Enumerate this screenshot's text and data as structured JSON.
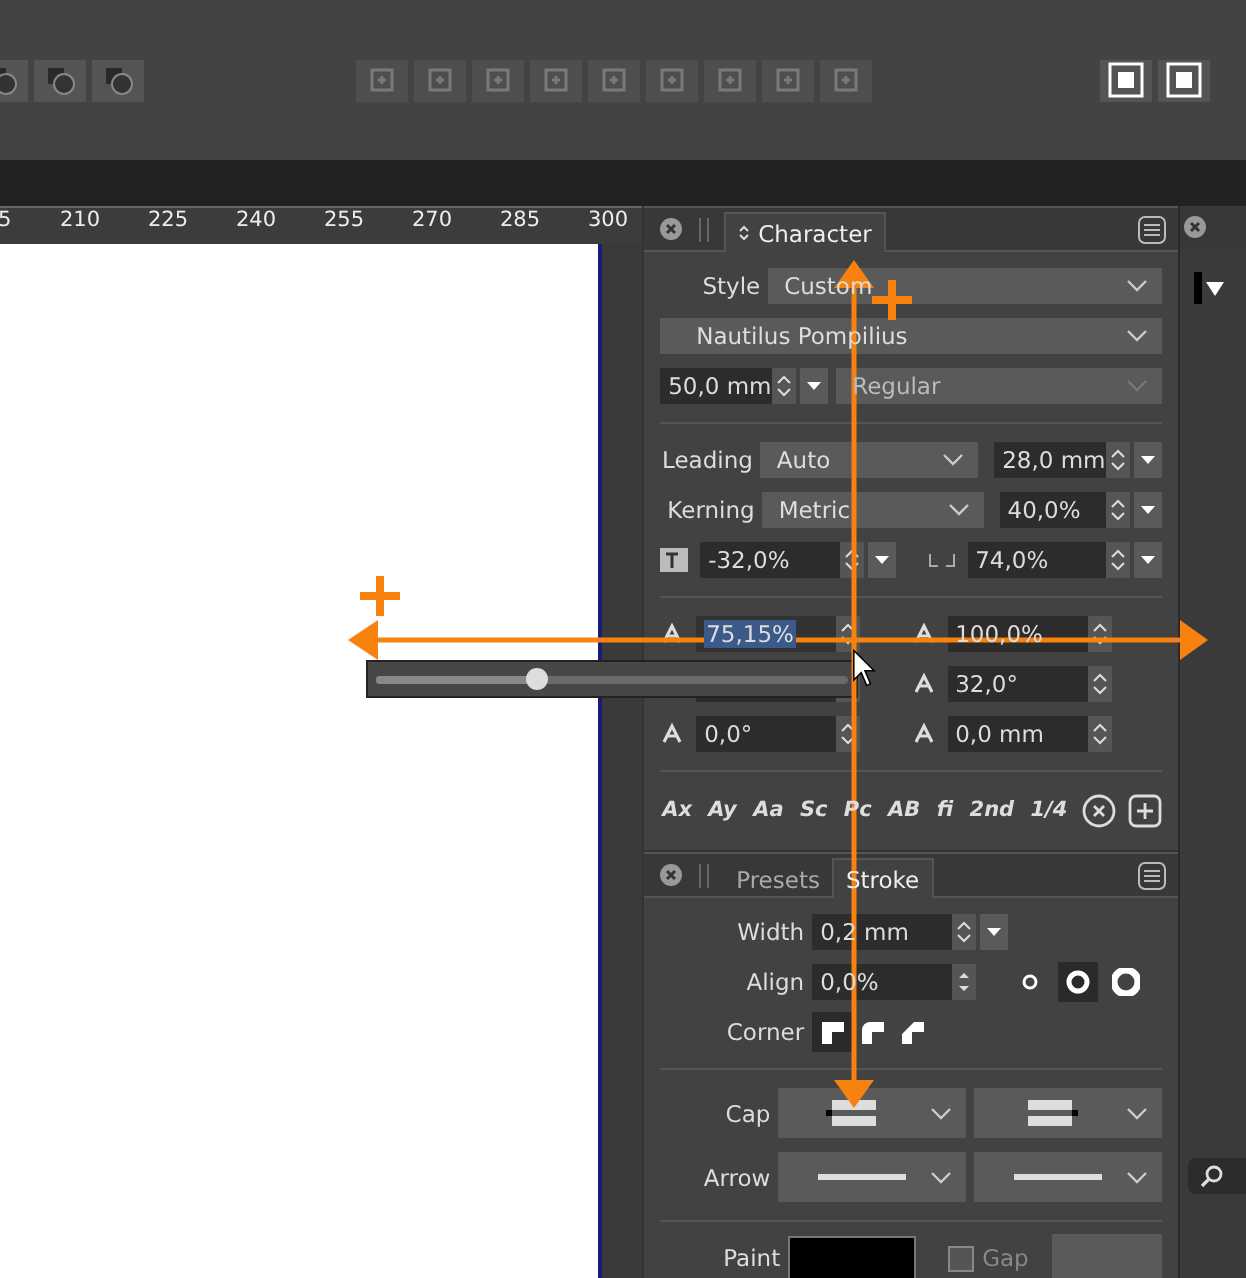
{
  "ruler": {
    "labels": [
      "5",
      "210",
      "225",
      "240",
      "255",
      "270",
      "285",
      "300"
    ]
  },
  "character_panel": {
    "tab": {
      "label": "Character",
      "selected": true
    },
    "style": {
      "label": "Style",
      "value": "Custom"
    },
    "font": {
      "value": "Nautilus Pompilius"
    },
    "size": {
      "value": "50,0 mm"
    },
    "weight": {
      "value": "Regular",
      "disabled": true
    },
    "leading": {
      "label": "Leading",
      "value": "Auto",
      "amount": "28,0 mm"
    },
    "kerning": {
      "label": "Kerning",
      "value": "Metric",
      "amount": "40,0%"
    },
    "tracking": {
      "value": "-32,0%"
    },
    "scale": {
      "value": "74,0%"
    },
    "fields": [
      {
        "value": "75,15%",
        "selected": true
      },
      {
        "value": "100,0%",
        "selected": false
      },
      {
        "selected": false
      },
      {
        "value": "32,0°",
        "selected": false
      },
      {
        "value": "0,0°",
        "selected": false
      },
      {
        "value": "0,0 mm",
        "selected": false
      }
    ],
    "typography_buttons": [
      "Ax",
      "Ay",
      "Aa",
      "Sc",
      "Pc",
      "AB",
      "fi",
      "2nd",
      "1/4"
    ]
  },
  "slider_popup": {
    "level": 0.34
  },
  "stroke_panel": {
    "tabs": [
      {
        "label": "Presets",
        "selected": false
      },
      {
        "label": "Stroke",
        "selected": true
      }
    ],
    "width": {
      "label": "Width",
      "value": "0,2 mm"
    },
    "align": {
      "label": "Align",
      "value": "0,0%",
      "options": [
        {
          "selected": false
        },
        {
          "selected": true
        },
        {
          "selected": false
        }
      ]
    },
    "corner": {
      "label": "Corner",
      "options": [
        {
          "selected": true
        },
        {
          "selected": false
        },
        {
          "selected": false
        }
      ]
    },
    "cap": {
      "label": "Cap"
    },
    "arrow": {
      "label": "Arrow"
    },
    "paint": {
      "label": "Paint"
    },
    "gap": {
      "label": "Gap",
      "checked": false
    }
  }
}
